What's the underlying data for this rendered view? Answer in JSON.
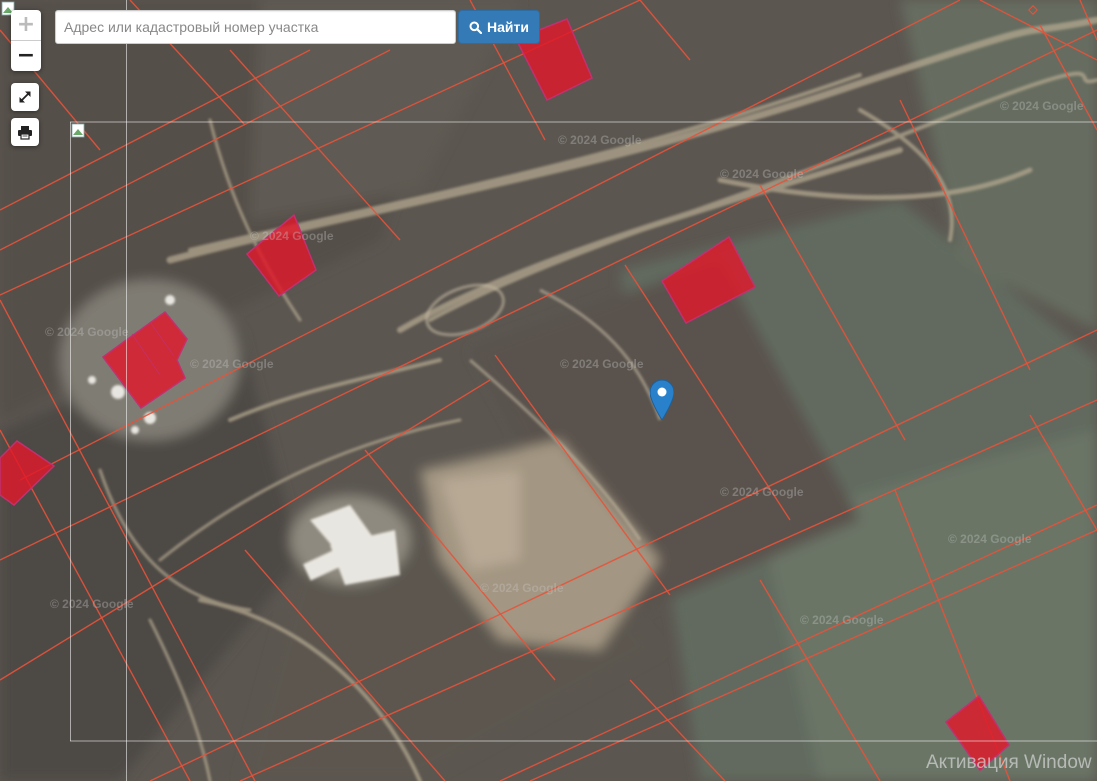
{
  "search": {
    "placeholder": "Адрес или кадастровый номер участка",
    "value": "",
    "button_label": "Найти",
    "button_icon": "search-icon"
  },
  "controls": {
    "zoom_in": "+",
    "zoom_out": "−",
    "fullscreen_icon": "expand-icon",
    "print_icon": "print-icon"
  },
  "map": {
    "imagery": "satellite",
    "attribution_watermark": "© 2024 Google",
    "boundary_color": "#e8523a",
    "highlight_fill": "#e0182a"
  },
  "overlay": {
    "activation_text": "Активация Window"
  },
  "colors": {
    "button_blue": "#337ab7",
    "marker_blue": "#2a81cb"
  }
}
